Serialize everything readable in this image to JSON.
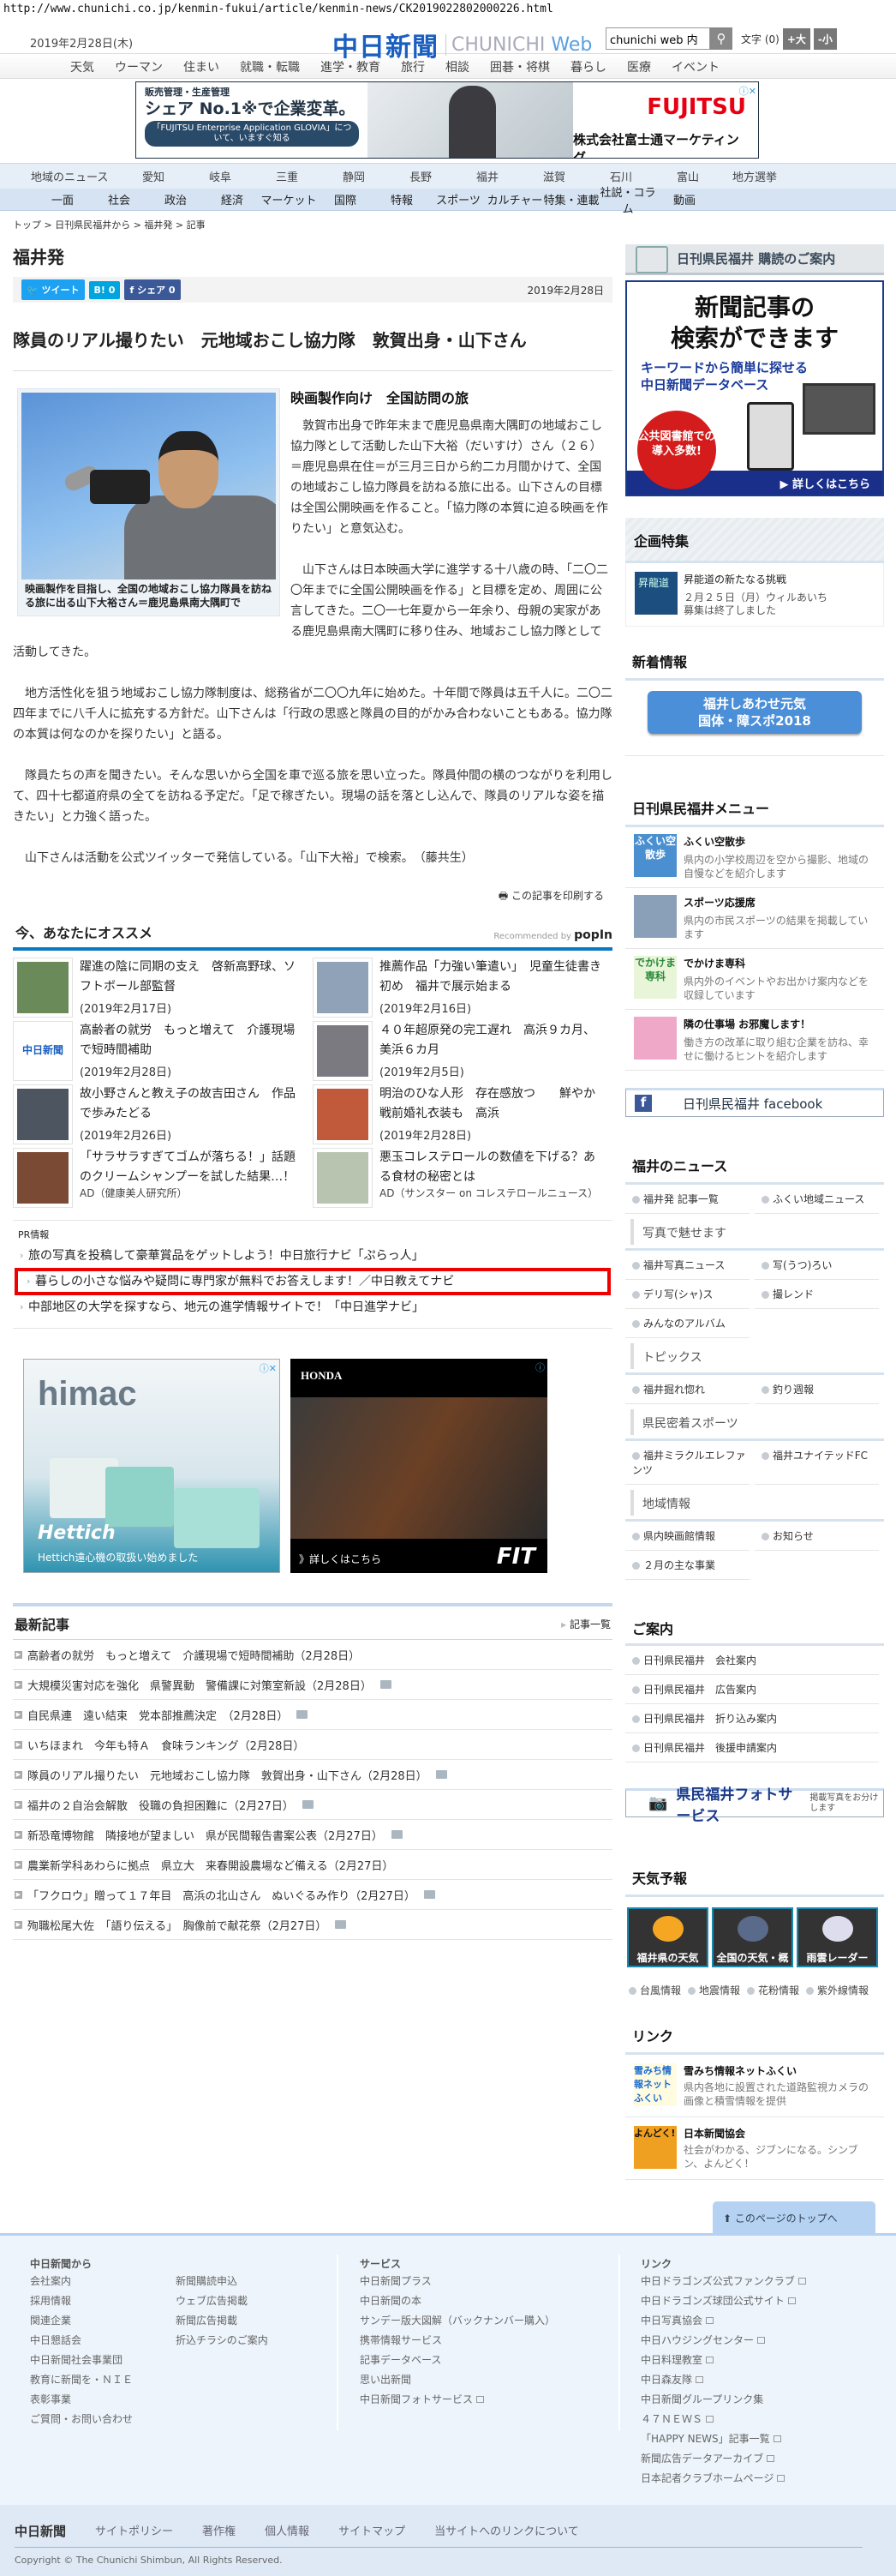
{
  "url": "http://www.chunichi.co.jp/kenmin-fukui/article/kenmin-news/CK2019022802000226.html",
  "header": {
    "date": "2019年2月28日(木)",
    "logo_jp": "中日新聞",
    "logo_en_1": "CHUNICHI",
    "logo_en_2": "Web",
    "search_value": "chunichi web 内",
    "font_size_label": "文字 (0)",
    "font_bigger": "+大",
    "font_smaller": "-小"
  },
  "nav_top": [
    "天気",
    "ウーマン",
    "住まい",
    "就職・転職",
    "進学・教育",
    "旅行",
    "相談",
    "囲碁・将棋",
    "暮らし",
    "医療",
    "イベント"
  ],
  "top_ad": {
    "small": "販売管理・生産管理",
    "big": "シェア No.1※で企業変革。",
    "pill": "「FUJITSU Enterprise Application GLOVIA」について、いますぐ知る",
    "brand": "FUJITSU",
    "company": "株式会社富士通マーケティング"
  },
  "nav_region": {
    "label": "地域のニュース",
    "items": [
      "愛知",
      "岐阜",
      "三重",
      "静岡",
      "長野",
      "福井",
      "滋賀",
      "石川",
      "富山",
      "地方選挙"
    ]
  },
  "nav_category": [
    "一面",
    "社会",
    "政治",
    "経済",
    "マーケット",
    "国際",
    "特報",
    "スポーツ",
    "カルチャー",
    "特集・連載",
    "社説・コラム",
    "動画"
  ],
  "breadcrumb": "トップ > 日刊県民福井から > 福井発 > 記事",
  "section_title": "福井発",
  "share": {
    "tweet": "ツイート",
    "hatena": "B! 0",
    "facebook": "シェア 0",
    "date": "2019年2月28日"
  },
  "article": {
    "headline": "隊員のリアル撮りたい　元地域おこし協力隊　敦賀出身・山下さん",
    "photo_caption": "映画製作を目指し、全国の地域おこし協力隊員を訪ねる旅に出る山下大裕さん＝鹿児島県南大隅町で",
    "subhead": "映画製作向け　全国訪問の旅",
    "paragraphs": [
      "敦賀市出身で昨年末まで鹿児島県南大隅町の地域おこし協力隊として活動した山下大裕（だいすけ）さん（２６）＝鹿児島県在住＝が三月三日から約二カ月間かけて、全国の地域おこし協力隊員を訪ねる旅に出る。山下さんの目標は全国公開映画を作ること。「協力隊の本質に迫る映画を作りたい」と意気込む。",
      "山下さんは日本映画大学に進学する十八歳の時、「二〇二〇年までに全国公開映画を作る」と目標を定め、周囲に公言してきた。二〇一七年夏から一年余り、母親の実家がある鹿児島県南大隅町に移り住み、地域おこし協力隊として活動してきた。",
      "地方活性化を狙う地域おこし協力隊制度は、総務省が二〇〇九年に始めた。十年間で隊員は五千人に。二〇二四年までに八千人に拡充する方針だ。山下さんは「行政の思惑と隊員の目的がかみ合わないこともある。協力隊の本質は何なのかを探りたい」と語る。",
      "隊員たちの声を聞きたい。そんな思いから全国を車で巡る旅を思い立った。隊員仲間の横のつながりを利用して、四十七都道府県の全てを訪ねる予定だ。「足で稼ぎたい。現場の話を落とし込んで、隊員のリアルな姿を描きたい」と力強く語った。",
      "山下さんは活動を公式ツイッターで発信している。「山下大裕」で検索。　（藤共生）"
    ],
    "print": "この記事を印刷する"
  },
  "recommend": {
    "title": "今、あなたにオススメ",
    "by": "Recommended by",
    "by_brand": "popIn",
    "items": [
      {
        "title": "躍進の陰に同期の支え　啓新高野球、ソフトボール部監督",
        "date": "(2019年2月17日)",
        "color": "#6a8a5a"
      },
      {
        "title": "推薦作品「力強い筆遣い」　児童生徒書き初め　福井で展示始まる",
        "date": "(2019年2月16日)",
        "color": "#8fa2b8"
      },
      {
        "title": "高齢者の就労　もっと増えて　介護現場で短時間補助",
        "date": "(2019年2月28日)",
        "color": "#ffffff",
        "logo": "中日新聞"
      },
      {
        "title": "４０年超原発の完工遅れ　高浜９カ月、美浜６カ月",
        "date": "(2019年2月5日)",
        "color": "#7a7a80"
      },
      {
        "title": "故小野さんと教え子の故吉田さん　作品で歩みたどる",
        "date": "(2019年2月26日)",
        "color": "#4c5560"
      },
      {
        "title": "明治のひな人形　存在感放つ　　鮮やか戦前婚礼衣装も　高浜",
        "date": "(2019年2月28日)",
        "color": "#c05a3a"
      },
      {
        "title": "「サラサラすぎてゴムが落ちる！」話題のクリームシャンプーを試した結果…！",
        "ad": "AD（健康美人研究所）",
        "color": "#7a4a35"
      },
      {
        "title": "悪玉コレステロールの数値を下げる？ある食材の秘密とは",
        "ad": "AD（サンスター on コレステロールニュース）",
        "color": "#b8c4b0"
      }
    ]
  },
  "pr": {
    "label": "PR情報",
    "items": [
      "旅の写真を投稿して豪華賞品をゲットしよう！中日旅行ナビ「ぷらっ人」",
      "暮らしの小さな悩みや疑問に専門家が無料でお答えします！／中日教えてナビ",
      "中部地区の大学を探すなら、地元の進学情報サイトで！「中日進学ナビ」"
    ]
  },
  "ads": {
    "himac_logo": "himac",
    "hettich": "Hettich",
    "himac_copy": "Hettich遠心機の取扱い始めました",
    "honda": "HONDA",
    "honda_more": "》詳しくはこちら",
    "fit": "FIT"
  },
  "latest": {
    "title": "最新記事",
    "more": "記事一覧",
    "items": [
      {
        "text": "高齢者の就労　もっと増えて　介護現場で短時間補助（2月28日）",
        "photo": false
      },
      {
        "text": "大規模災害対応を強化　県警異動　警備課に対策室新設（2月28日）",
        "photo": true
      },
      {
        "text": "自民県連　遠い結束　党本部推薦決定　（2月28日）",
        "photo": true
      },
      {
        "text": "いちほまれ　今年も特Ａ　食味ランキング（2月28日）",
        "photo": false
      },
      {
        "text": "隊員のリアル撮りたい　元地域おこし協力隊　敦賀出身・山下さん（2月28日）",
        "photo": true
      },
      {
        "text": "福井の２自治会解散　役職の負担困難に（2月27日）",
        "photo": true
      },
      {
        "text": "新恐竜博物館　隣接地が望ましい　県が民間報告書案公表（2月27日）",
        "photo": true
      },
      {
        "text": "農業新学科あわらに拠点　県立大　来春開設農場など備える（2月27日）",
        "photo": false
      },
      {
        "text": "「フクロウ」贈って１７年目　高浜の北山さん　ぬいぐるみ作り（2月27日）",
        "photo": true
      },
      {
        "text": "殉職松尾大佐　「語り伝える」　胸像前で献花祭（2月27日）",
        "photo": true
      }
    ]
  },
  "sidebar": {
    "subscribe": "日刊県民福井 購読のご案内",
    "db_ad": {
      "line1": "新聞記事の",
      "line2": "検索ができます",
      "blue1": "キーワードから簡単に探せる",
      "blue2": "中日新聞データベース",
      "circle": "公共図書館での導入多数!",
      "more": "▶ 詳しくはこちら"
    },
    "kikaku": {
      "title": "企画特集",
      "item_title": "昇能道の新たなる挑戦",
      "item_sub1": "２月２５日（月）ウィルあいち",
      "item_sub2": "募集は終了しました",
      "thumb": "昇龍道"
    },
    "shinchaku": {
      "title": "新着情報",
      "banner1": "福井しあわせ元気",
      "banner2": "国体・障スポ2018"
    },
    "menu": {
      "title": "日刊県民福井メニュー",
      "items": [
        {
          "title": "ふくい空散歩",
          "desc": "県内の小学校周辺を空から撮影、地域の自慢などを紹介します",
          "thumb": "ふくい空散歩",
          "color": "#4a90d0"
        },
        {
          "title": "スポーツ応援席",
          "desc": "県内の市民スポーツの結果を掲載しています",
          "thumb": "",
          "color": "#8aa0b8"
        },
        {
          "title": "でかけま専科",
          "desc": "県内外のイベントやお出かけ案内などを収録しています",
          "thumb": "でかけま専科",
          "color": "#e8f5d8"
        },
        {
          "title": "隣の仕事場 お邪魔します！",
          "desc": "働き方の改革に取り組む企業を訪ね、幸せに働けるヒントを紹介します",
          "thumb": "",
          "color": "#f0a8c8"
        }
      ]
    },
    "facebook": "日刊県民福井 facebook",
    "news": {
      "title": "福井のニュース",
      "top": [
        "福井発 記事一覧",
        "ふくい地域ニュース"
      ],
      "groups": [
        {
          "title": "写真で魅せます",
          "items": [
            "福井写真ニュース",
            "写(うつ)ろい",
            "デリ写(シャ)ス",
            "撮レンド",
            "みんなのアルバム"
          ]
        },
        {
          "title": "トピックス",
          "items": [
            "福井掘れ惚れ",
            "釣り週報"
          ]
        },
        {
          "title": "県民密着スポーツ",
          "items": [
            "福井ミラクルエレファンツ",
            "福井ユナイテッドFC"
          ]
        },
        {
          "title": "地域情報",
          "items": [
            "県内映画館情報",
            "お知らせ",
            "２月の主な事業"
          ]
        }
      ]
    },
    "annai": {
      "title": "ご案内",
      "items": [
        "日刊県民福井　会社案内",
        "日刊県民福井　広告案内",
        "日刊県民福井　折り込み案内",
        "日刊県民福井　後援申請案内"
      ]
    },
    "photo_service": {
      "title": "県民福井フォトサービス",
      "sub": "掲載写真をお分けします"
    },
    "weather": {
      "title": "天気予報",
      "tiles": [
        "福井県の天気",
        "全国の天気・概況",
        "雨雲レーダー"
      ],
      "links": [
        "台風情報",
        "地震情報",
        "花粉情報",
        "紫外線情報"
      ]
    },
    "links": {
      "title": "リンク",
      "items": [
        {
          "title": "雪みち情報ネットふくい",
          "desc": "県内各地に設置された道路監視カメラの画像と積雪情報を提供",
          "thumb": "雪みち情報ネットふくい"
        },
        {
          "title": "日本新聞協会",
          "desc": "社会がわかる、ジブンになる。シンブン、よんどく！",
          "thumb": "よんどく!"
        }
      ]
    }
  },
  "footer": {
    "to_top": "このページのトップへ",
    "col1_title": "中日新聞から",
    "col1": [
      "会社案内",
      "採用情報",
      "関連企業",
      "中日懇話会",
      "中日新聞社会事業団",
      "教育に新聞を・ＮＩＥ",
      "表彰事業",
      "ご質問・お問い合わせ"
    ],
    "col2": [
      "新聞購読申込",
      "ウェブ広告掲載",
      "新聞広告掲載",
      "折込チラシのご案内"
    ],
    "col3_title": "サービス",
    "col3": [
      "中日新聞プラス",
      "中日新聞の本",
      "サンデー版大図解（バックナンバー購入）",
      "携帯情報サービス",
      "記事データベース",
      "思い出新聞",
      "中日新聞フォトサービス"
    ],
    "col4_title": "リンク",
    "col4": [
      "中日ドラゴンズ公式ファンクラブ",
      "中日ドラゴンズ球団公式サイト",
      "中日写真協会",
      "中日ハウジングセンター",
      "中日料理教室",
      "中日森友隊",
      "中日新聞グループリンク集",
      "４７ＮＥＷＳ",
      "「HAPPY NEWS」記事一覧",
      "新聞広告データアーカイブ",
      "日本記者クラブホームページ"
    ],
    "bottom_logo": "中日新聞",
    "bottom_links": [
      "サイトポリシー",
      "著作権",
      "個人情報",
      "サイトマップ",
      "当サイトへのリンクについて"
    ],
    "copyright": "Copyright © The Chunichi Shimbun, All Rights Reserved."
  }
}
